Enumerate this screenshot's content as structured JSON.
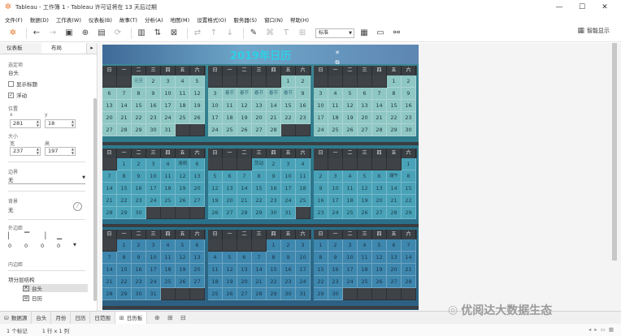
{
  "window": {
    "title": "Tableau - 工作簿 1 - Tableau 许可证将在 13 天后过期",
    "controls": [
      "—",
      "☐",
      "✕"
    ]
  },
  "menu": [
    "文件(F)",
    "数据(D)",
    "工作表(W)",
    "仪表板(B)",
    "故事(T)",
    "分析(A)",
    "地图(M)",
    "设置格式(O)",
    "服务器(S)",
    "窗口(N)",
    "帮助(H)"
  ],
  "toolbar": {
    "fit_value": "标准",
    "smart_show_label": "智能显示"
  },
  "left_panel": {
    "tabs": [
      "仪表板",
      "布局"
    ],
    "selected_item_label": "选定项",
    "selected_item_value": "台头",
    "show_title_label": "显示标题",
    "floating_label": "浮动",
    "position_label": "位置",
    "x_label": "x",
    "y_label": "y",
    "x_value": "281",
    "y_value": "18",
    "size_label": "大小",
    "width_label": "宽",
    "height_label": "高",
    "width_value": "237",
    "height_value": "197",
    "border_label": "边界",
    "border_value": "无",
    "background_label": "背景",
    "background_value": "无",
    "outer_padding_label": "外边距",
    "outer_padding_values": [
      "0",
      "0",
      "0",
      "0"
    ],
    "inner_padding_label": "内边距",
    "hierarchy_label": "项分层结构",
    "hierarchy_items": [
      "台头",
      "日历"
    ]
  },
  "dashboard": {
    "title": "2019年日历",
    "weekday_headers": [
      "日",
      "一",
      "二",
      "三",
      "四",
      "五",
      "六"
    ],
    "months": [
      {
        "weeks": [
          [
            "",
            "",
            "元旦",
            "2",
            "3",
            "4",
            "5"
          ],
          [
            "6",
            "7",
            "8",
            "9",
            "10",
            "11",
            "12"
          ],
          [
            "13",
            "14",
            "15",
            "16",
            "17",
            "18",
            "19"
          ],
          [
            "20",
            "21",
            "22",
            "23",
            "24",
            "25",
            "26"
          ],
          [
            "27",
            "28",
            "29",
            "30",
            "31",
            "",
            ""
          ]
        ]
      },
      {
        "weeks": [
          [
            "",
            "",
            "",
            "",
            "",
            "1",
            "2"
          ],
          [
            "3",
            "春节",
            "春节",
            "春节",
            "春节",
            "春节",
            "9"
          ],
          [
            "10",
            "11",
            "12",
            "13",
            "14",
            "15",
            "16"
          ],
          [
            "17",
            "18",
            "19",
            "20",
            "21",
            "22",
            "23"
          ],
          [
            "24",
            "25",
            "26",
            "27",
            "28",
            "",
            ""
          ]
        ]
      },
      {
        "weeks": [
          [
            "",
            "",
            "",
            "",
            "",
            "1",
            "2"
          ],
          [
            "3",
            "4",
            "5",
            "6",
            "7",
            "8",
            "9"
          ],
          [
            "10",
            "11",
            "12",
            "13",
            "14",
            "15",
            "16"
          ],
          [
            "17",
            "18",
            "19",
            "20",
            "21",
            "22",
            "23"
          ],
          [
            "24",
            "25",
            "26",
            "27",
            "28",
            "29",
            "30"
          ]
        ]
      },
      {
        "weeks": [
          [
            "",
            "1",
            "2",
            "3",
            "4",
            "清明",
            "6"
          ],
          [
            "7",
            "8",
            "9",
            "10",
            "11",
            "12",
            "13"
          ],
          [
            "14",
            "15",
            "16",
            "17",
            "18",
            "19",
            "20"
          ],
          [
            "21",
            "22",
            "23",
            "24",
            "25",
            "26",
            "27"
          ],
          [
            "28",
            "29",
            "30",
            "",
            "",
            "",
            ""
          ]
        ]
      },
      {
        "weeks": [
          [
            "",
            "",
            "",
            "劳动",
            "2",
            "3",
            "4"
          ],
          [
            "5",
            "6",
            "7",
            "8",
            "9",
            "10",
            "11"
          ],
          [
            "12",
            "13",
            "14",
            "15",
            "16",
            "17",
            "18"
          ],
          [
            "19",
            "20",
            "21",
            "22",
            "23",
            "24",
            "25"
          ],
          [
            "26",
            "27",
            "28",
            "29",
            "30",
            "31",
            ""
          ]
        ]
      },
      {
        "weeks": [
          [
            "",
            "",
            "",
            "",
            "",
            "",
            "1"
          ],
          [
            "2",
            "3",
            "4",
            "5",
            "6",
            "端午",
            "8"
          ],
          [
            "9",
            "10",
            "11",
            "12",
            "13",
            "14",
            "15"
          ],
          [
            "16",
            "17",
            "18",
            "19",
            "20",
            "21",
            "22"
          ],
          [
            "23",
            "24",
            "25",
            "26",
            "27",
            "28",
            "29"
          ]
        ]
      },
      {
        "weeks": [
          [
            "",
            "1",
            "2",
            "3",
            "4",
            "5",
            "6"
          ],
          [
            "7",
            "8",
            "9",
            "10",
            "11",
            "12",
            "13"
          ],
          [
            "14",
            "15",
            "16",
            "17",
            "18",
            "19",
            "20"
          ],
          [
            "21",
            "22",
            "23",
            "24",
            "25",
            "26",
            "27"
          ],
          [
            "28",
            "29",
            "30",
            "31",
            "",
            "",
            ""
          ]
        ]
      },
      {
        "weeks": [
          [
            "",
            "",
            "",
            "",
            "1",
            "2",
            "3"
          ],
          [
            "4",
            "5",
            "6",
            "7",
            "8",
            "9",
            "10"
          ],
          [
            "11",
            "12",
            "13",
            "14",
            "15",
            "16",
            "17"
          ],
          [
            "18",
            "19",
            "20",
            "21",
            "22",
            "23",
            "24"
          ],
          [
            "25",
            "26",
            "27",
            "28",
            "29",
            "30",
            "31"
          ]
        ]
      },
      {
        "weeks": [
          [
            "1",
            "2",
            "3",
            "4",
            "5",
            "6",
            "7"
          ],
          [
            "8",
            "9",
            "10",
            "11",
            "12",
            "13",
            "14"
          ],
          [
            "15",
            "16",
            "17",
            "18",
            "19",
            "20",
            "21"
          ],
          [
            "22",
            "23",
            "24",
            "25",
            "26",
            "27",
            "28"
          ],
          [
            "29",
            "30",
            "",
            "",
            "",
            "",
            ""
          ]
        ]
      }
    ]
  },
  "sheet_tabs": [
    "数据源",
    "台头",
    "月份",
    "日历",
    "日范围",
    "日历板"
  ],
  "active_sheet_tab": "日历板",
  "status": {
    "marks": "1 个标记",
    "rows_cols": "1 行 x 1 列"
  },
  "watermark": "优阅达大数据生态"
}
